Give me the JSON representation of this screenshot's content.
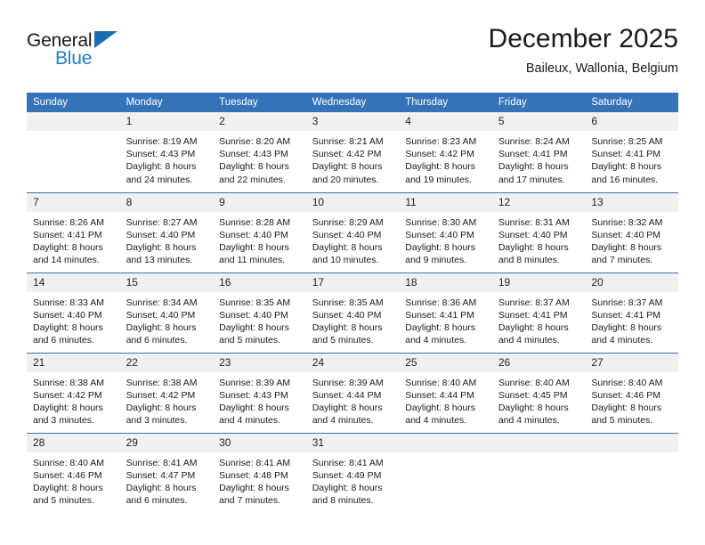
{
  "brand": {
    "name_part1": "General",
    "name_part2": "Blue",
    "triangle_color": "#1b6cb0",
    "blue_color": "#1b81d4"
  },
  "header": {
    "title": "December 2025",
    "subtitle": "Baileux, Wallonia, Belgium"
  },
  "theme": {
    "header_row_bg": "#3573b9",
    "daynum_bg": "#f0f0f0",
    "rule_color": "#3573b9",
    "text_color": "#1a1a1a"
  },
  "weekday_headers": [
    "Sunday",
    "Monday",
    "Tuesday",
    "Wednesday",
    "Thursday",
    "Friday",
    "Saturday"
  ],
  "labels": {
    "sunrise_prefix": "Sunrise:",
    "sunset_prefix": "Sunset:",
    "daylight_prefix": "Daylight:"
  },
  "weeks": [
    [
      {
        "day": "",
        "sunrise": "",
        "sunset": "",
        "daylight_line1": "",
        "daylight_line2": ""
      },
      {
        "day": "1",
        "sunrise": "Sunrise: 8:19 AM",
        "sunset": "Sunset: 4:43 PM",
        "daylight_line1": "Daylight: 8 hours",
        "daylight_line2": "and 24 minutes."
      },
      {
        "day": "2",
        "sunrise": "Sunrise: 8:20 AM",
        "sunset": "Sunset: 4:43 PM",
        "daylight_line1": "Daylight: 8 hours",
        "daylight_line2": "and 22 minutes."
      },
      {
        "day": "3",
        "sunrise": "Sunrise: 8:21 AM",
        "sunset": "Sunset: 4:42 PM",
        "daylight_line1": "Daylight: 8 hours",
        "daylight_line2": "and 20 minutes."
      },
      {
        "day": "4",
        "sunrise": "Sunrise: 8:23 AM",
        "sunset": "Sunset: 4:42 PM",
        "daylight_line1": "Daylight: 8 hours",
        "daylight_line2": "and 19 minutes."
      },
      {
        "day": "5",
        "sunrise": "Sunrise: 8:24 AM",
        "sunset": "Sunset: 4:41 PM",
        "daylight_line1": "Daylight: 8 hours",
        "daylight_line2": "and 17 minutes."
      },
      {
        "day": "6",
        "sunrise": "Sunrise: 8:25 AM",
        "sunset": "Sunset: 4:41 PM",
        "daylight_line1": "Daylight: 8 hours",
        "daylight_line2": "and 16 minutes."
      }
    ],
    [
      {
        "day": "7",
        "sunrise": "Sunrise: 8:26 AM",
        "sunset": "Sunset: 4:41 PM",
        "daylight_line1": "Daylight: 8 hours",
        "daylight_line2": "and 14 minutes."
      },
      {
        "day": "8",
        "sunrise": "Sunrise: 8:27 AM",
        "sunset": "Sunset: 4:40 PM",
        "daylight_line1": "Daylight: 8 hours",
        "daylight_line2": "and 13 minutes."
      },
      {
        "day": "9",
        "sunrise": "Sunrise: 8:28 AM",
        "sunset": "Sunset: 4:40 PM",
        "daylight_line1": "Daylight: 8 hours",
        "daylight_line2": "and 11 minutes."
      },
      {
        "day": "10",
        "sunrise": "Sunrise: 8:29 AM",
        "sunset": "Sunset: 4:40 PM",
        "daylight_line1": "Daylight: 8 hours",
        "daylight_line2": "and 10 minutes."
      },
      {
        "day": "11",
        "sunrise": "Sunrise: 8:30 AM",
        "sunset": "Sunset: 4:40 PM",
        "daylight_line1": "Daylight: 8 hours",
        "daylight_line2": "and 9 minutes."
      },
      {
        "day": "12",
        "sunrise": "Sunrise: 8:31 AM",
        "sunset": "Sunset: 4:40 PM",
        "daylight_line1": "Daylight: 8 hours",
        "daylight_line2": "and 8 minutes."
      },
      {
        "day": "13",
        "sunrise": "Sunrise: 8:32 AM",
        "sunset": "Sunset: 4:40 PM",
        "daylight_line1": "Daylight: 8 hours",
        "daylight_line2": "and 7 minutes."
      }
    ],
    [
      {
        "day": "14",
        "sunrise": "Sunrise: 8:33 AM",
        "sunset": "Sunset: 4:40 PM",
        "daylight_line1": "Daylight: 8 hours",
        "daylight_line2": "and 6 minutes."
      },
      {
        "day": "15",
        "sunrise": "Sunrise: 8:34 AM",
        "sunset": "Sunset: 4:40 PM",
        "daylight_line1": "Daylight: 8 hours",
        "daylight_line2": "and 6 minutes."
      },
      {
        "day": "16",
        "sunrise": "Sunrise: 8:35 AM",
        "sunset": "Sunset: 4:40 PM",
        "daylight_line1": "Daylight: 8 hours",
        "daylight_line2": "and 5 minutes."
      },
      {
        "day": "17",
        "sunrise": "Sunrise: 8:35 AM",
        "sunset": "Sunset: 4:40 PM",
        "daylight_line1": "Daylight: 8 hours",
        "daylight_line2": "and 5 minutes."
      },
      {
        "day": "18",
        "sunrise": "Sunrise: 8:36 AM",
        "sunset": "Sunset: 4:41 PM",
        "daylight_line1": "Daylight: 8 hours",
        "daylight_line2": "and 4 minutes."
      },
      {
        "day": "19",
        "sunrise": "Sunrise: 8:37 AM",
        "sunset": "Sunset: 4:41 PM",
        "daylight_line1": "Daylight: 8 hours",
        "daylight_line2": "and 4 minutes."
      },
      {
        "day": "20",
        "sunrise": "Sunrise: 8:37 AM",
        "sunset": "Sunset: 4:41 PM",
        "daylight_line1": "Daylight: 8 hours",
        "daylight_line2": "and 4 minutes."
      }
    ],
    [
      {
        "day": "21",
        "sunrise": "Sunrise: 8:38 AM",
        "sunset": "Sunset: 4:42 PM",
        "daylight_line1": "Daylight: 8 hours",
        "daylight_line2": "and 3 minutes."
      },
      {
        "day": "22",
        "sunrise": "Sunrise: 8:38 AM",
        "sunset": "Sunset: 4:42 PM",
        "daylight_line1": "Daylight: 8 hours",
        "daylight_line2": "and 3 minutes."
      },
      {
        "day": "23",
        "sunrise": "Sunrise: 8:39 AM",
        "sunset": "Sunset: 4:43 PM",
        "daylight_line1": "Daylight: 8 hours",
        "daylight_line2": "and 4 minutes."
      },
      {
        "day": "24",
        "sunrise": "Sunrise: 8:39 AM",
        "sunset": "Sunset: 4:44 PM",
        "daylight_line1": "Daylight: 8 hours",
        "daylight_line2": "and 4 minutes."
      },
      {
        "day": "25",
        "sunrise": "Sunrise: 8:40 AM",
        "sunset": "Sunset: 4:44 PM",
        "daylight_line1": "Daylight: 8 hours",
        "daylight_line2": "and 4 minutes."
      },
      {
        "day": "26",
        "sunrise": "Sunrise: 8:40 AM",
        "sunset": "Sunset: 4:45 PM",
        "daylight_line1": "Daylight: 8 hours",
        "daylight_line2": "and 4 minutes."
      },
      {
        "day": "27",
        "sunrise": "Sunrise: 8:40 AM",
        "sunset": "Sunset: 4:46 PM",
        "daylight_line1": "Daylight: 8 hours",
        "daylight_line2": "and 5 minutes."
      }
    ],
    [
      {
        "day": "28",
        "sunrise": "Sunrise: 8:40 AM",
        "sunset": "Sunset: 4:46 PM",
        "daylight_line1": "Daylight: 8 hours",
        "daylight_line2": "and 5 minutes."
      },
      {
        "day": "29",
        "sunrise": "Sunrise: 8:41 AM",
        "sunset": "Sunset: 4:47 PM",
        "daylight_line1": "Daylight: 8 hours",
        "daylight_line2": "and 6 minutes."
      },
      {
        "day": "30",
        "sunrise": "Sunrise: 8:41 AM",
        "sunset": "Sunset: 4:48 PM",
        "daylight_line1": "Daylight: 8 hours",
        "daylight_line2": "and 7 minutes."
      },
      {
        "day": "31",
        "sunrise": "Sunrise: 8:41 AM",
        "sunset": "Sunset: 4:49 PM",
        "daylight_line1": "Daylight: 8 hours",
        "daylight_line2": "and 8 minutes."
      },
      {
        "day": "",
        "sunrise": "",
        "sunset": "",
        "daylight_line1": "",
        "daylight_line2": ""
      },
      {
        "day": "",
        "sunrise": "",
        "sunset": "",
        "daylight_line1": "",
        "daylight_line2": ""
      },
      {
        "day": "",
        "sunrise": "",
        "sunset": "",
        "daylight_line1": "",
        "daylight_line2": ""
      }
    ]
  ]
}
